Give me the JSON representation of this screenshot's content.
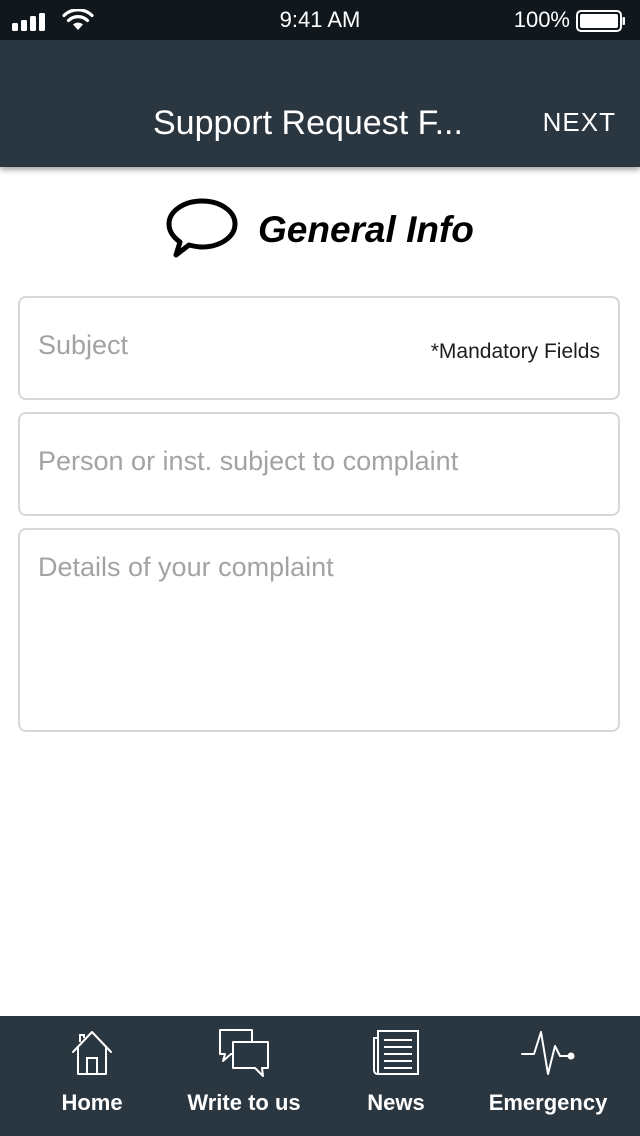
{
  "status_bar": {
    "time": "9:41 AM",
    "battery_percent": "100%",
    "signal_bars": 4,
    "battery_level": 1.0
  },
  "nav": {
    "title": "Support Request F...",
    "next_label": "NEXT"
  },
  "section": {
    "title": "General Info",
    "icon": "speech-bubble-icon"
  },
  "form": {
    "subject_placeholder": "Subject",
    "mandatory_note": "*Mandatory Fields",
    "person_placeholder": "Person or inst. subject to complaint",
    "details_placeholder": "Details of your complaint"
  },
  "tab_bar": {
    "items": [
      {
        "label": "Home",
        "icon": "home-icon"
      },
      {
        "label": "Write to us",
        "icon": "chat-bubbles-icon"
      },
      {
        "label": "News",
        "icon": "newspaper-icon"
      },
      {
        "label": "Emergency",
        "icon": "heartbeat-icon"
      }
    ]
  },
  "colors": {
    "bar_background": "#2b3740",
    "status_background": "#10171d",
    "field_border": "#d8d8d8",
    "placeholder_text": "#a3a3a3"
  }
}
